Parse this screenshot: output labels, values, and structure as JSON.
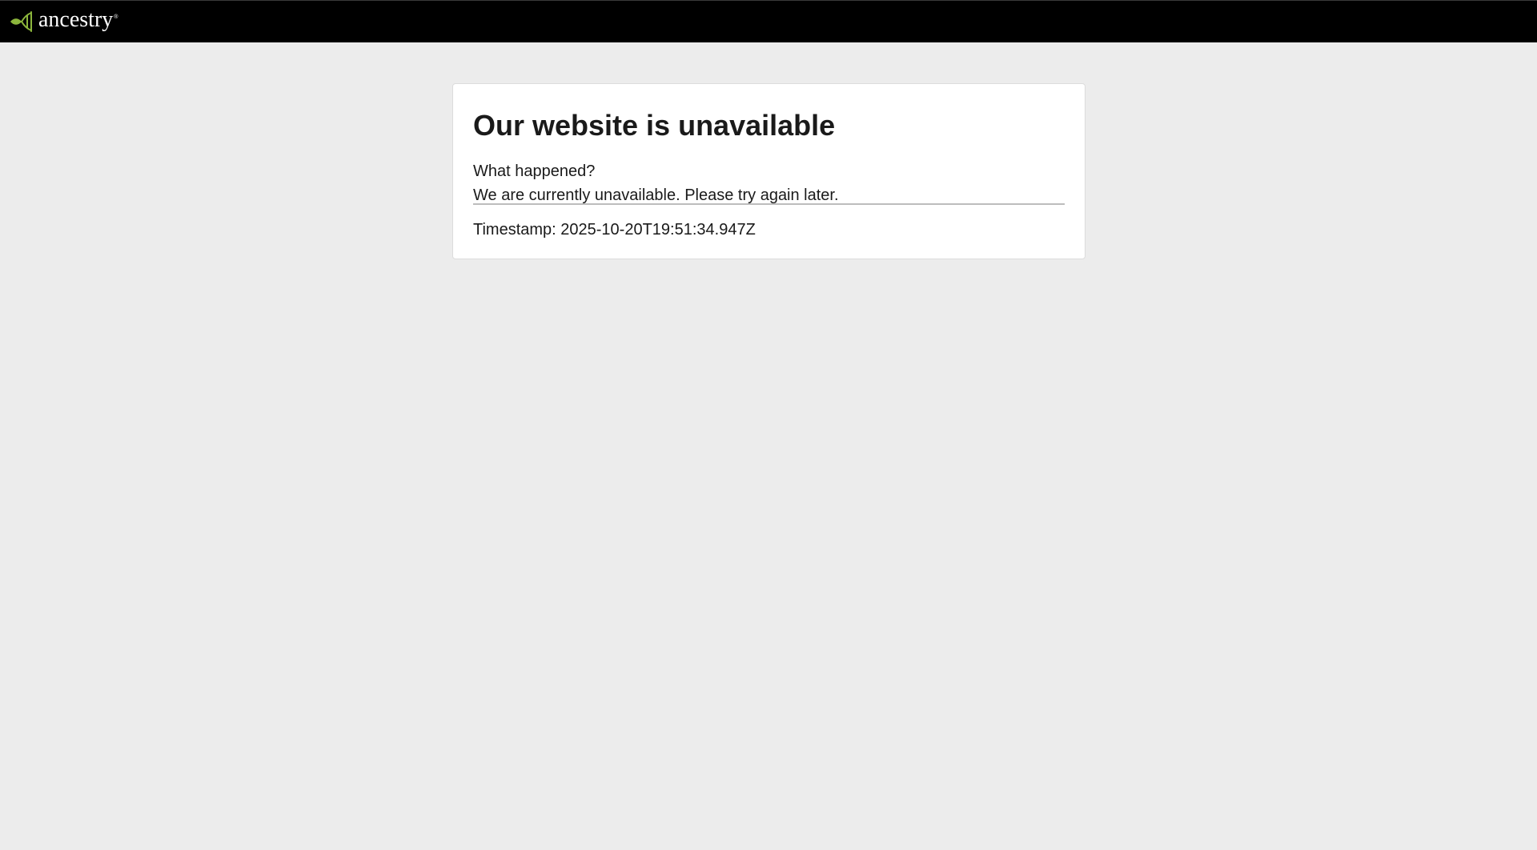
{
  "header": {
    "logo_text": "ancestry",
    "logo_trademark": "®",
    "logo_icon": "leaf-icon",
    "leaf_color": "#8cb63c"
  },
  "error_card": {
    "title": "Our website is unavailable",
    "question": "What happened?",
    "message": "We are currently unavailable. Please try again later.",
    "timestamp": "Timestamp: 2025-10-20T19:51:34.947Z"
  }
}
